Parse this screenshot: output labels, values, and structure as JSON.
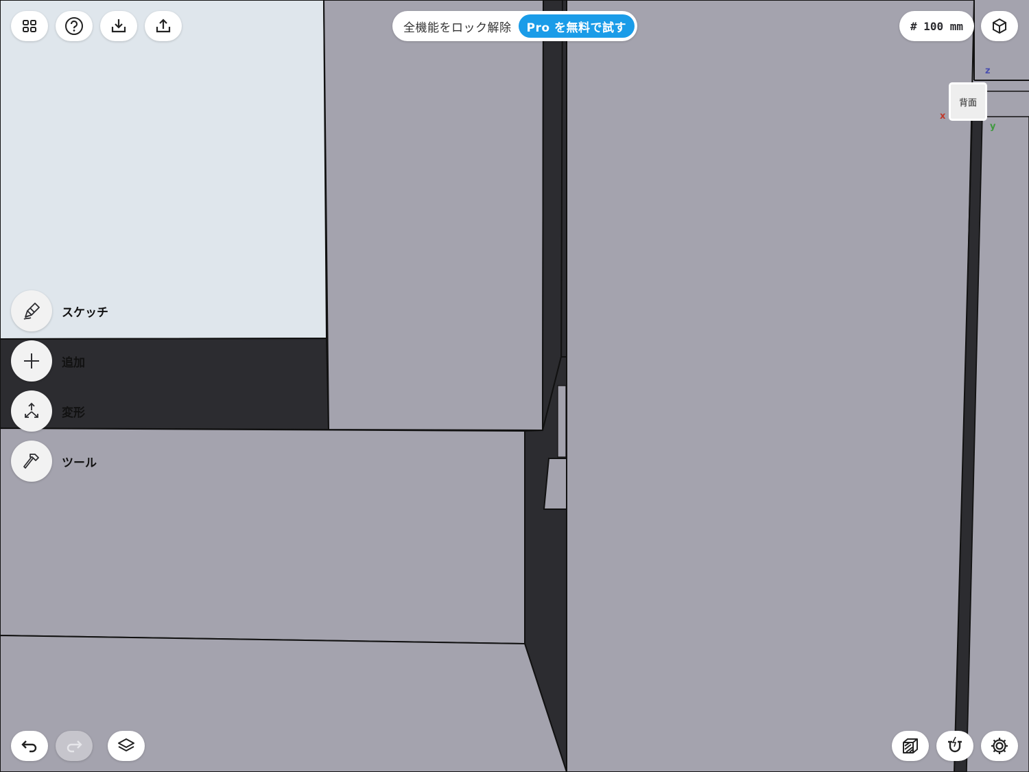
{
  "toolbar": {
    "icons": [
      "grid-icon",
      "help-icon",
      "download-icon",
      "share-icon"
    ]
  },
  "promo": {
    "text": "全機能をロック解除",
    "button_label": "Pro を無料で試す",
    "button_color": "#1a9ce8"
  },
  "grid_size": {
    "label": "# 100 mm"
  },
  "view": {
    "face_label": "背面",
    "axes": {
      "x": "x",
      "y": "y",
      "z": "z"
    },
    "axis_colors": {
      "x": "#c0392b",
      "y": "#3f9a3f",
      "z": "#4a4fb0"
    }
  },
  "side_menu": {
    "items": [
      {
        "label": "スケッチ",
        "icon": "sketch-pen-icon"
      },
      {
        "label": "追加",
        "icon": "plus-icon"
      },
      {
        "label": "変形",
        "icon": "transform-arrows-icon"
      },
      {
        "label": "ツール",
        "icon": "hammer-icon"
      }
    ]
  },
  "bottom_left": {
    "icons": [
      "undo-icon",
      "redo-icon",
      "layers-icon"
    ],
    "redo_enabled": false
  },
  "bottom_right": {
    "icons": [
      "section-view-icon",
      "snap-magnet-icon",
      "settings-gear-icon"
    ]
  },
  "colors": {
    "background_face": "#a4a3ae",
    "light_face": "#dfe6ec",
    "dark_face": "#2c2c30"
  }
}
